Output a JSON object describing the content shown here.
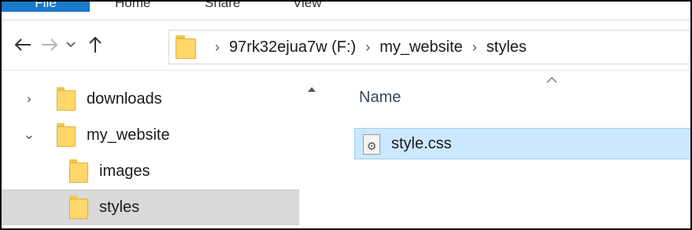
{
  "ribbon": {
    "tabs": [
      {
        "label": "File"
      },
      {
        "label": "Home"
      },
      {
        "label": "Share"
      },
      {
        "label": "View"
      }
    ]
  },
  "nav": {
    "back_icon": "back-arrow-icon",
    "forward_icon": "forward-arrow-icon",
    "recent_icon": "chevron-down-icon",
    "up_icon": "up-arrow-icon"
  },
  "address": {
    "crumbs": [
      "97rk32ejua7w (F:)",
      "my_website",
      "styles"
    ]
  },
  "tree": {
    "items": [
      {
        "label": "downloads",
        "chevron": "›",
        "selected": false
      },
      {
        "label": "my_website",
        "chevron": "⌄",
        "selected": false
      },
      {
        "label": "images",
        "chevron": "",
        "selected": false
      },
      {
        "label": "styles",
        "chevron": "",
        "selected": true
      }
    ]
  },
  "content": {
    "column_header": "Name",
    "files": [
      {
        "name": "style.css",
        "icon": "css-file-icon",
        "selected": true
      }
    ]
  },
  "colors": {
    "folder": "#ffd76a",
    "selection": "#cce8ff",
    "tree_selection": "#d9d9d9",
    "file_tab": "#1979ca"
  }
}
